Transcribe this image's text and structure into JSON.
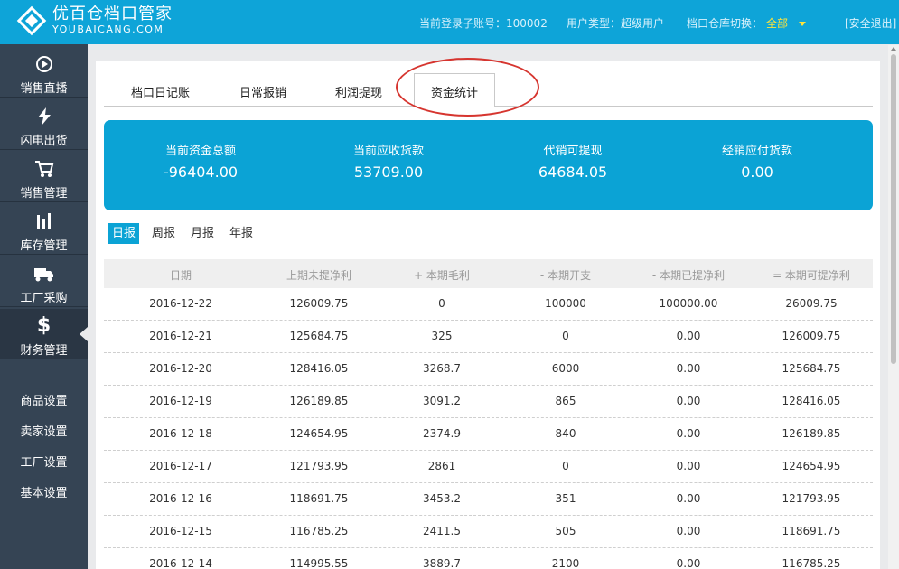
{
  "header": {
    "logo_cn": "优百仓档口管家",
    "logo_en": "YOUBAICANG.COM",
    "account_label": "当前登录子账号：",
    "account_value": "100002",
    "usertype_label": "用户类型：",
    "usertype_value": "超级用户",
    "switch_label": "档口仓库切换：",
    "switch_value": "全部",
    "logout": "[安全退出]"
  },
  "sidebar": {
    "items": [
      {
        "label": "销售直播",
        "icon": "play-circle-icon"
      },
      {
        "label": "闪电出货",
        "icon": "lightning-icon"
      },
      {
        "label": "销售管理",
        "icon": "cart-icon"
      },
      {
        "label": "库存管理",
        "icon": "bar-chart-icon"
      },
      {
        "label": "工厂采购",
        "icon": "truck-icon"
      },
      {
        "label": "财务管理",
        "icon": "dollar-icon"
      }
    ],
    "sub_items": [
      "商品设置",
      "卖家设置",
      "工厂设置",
      "基本设置"
    ]
  },
  "tabs": [
    "档口日记账",
    "日常报销",
    "利润提现",
    "资金统计"
  ],
  "summary": [
    {
      "title": "当前资金总额",
      "value": "-96404.00"
    },
    {
      "title": "当前应收货款",
      "value": "53709.00"
    },
    {
      "title": "代销可提现",
      "value": "64684.05"
    },
    {
      "title": "经销应付货款",
      "value": "0.00"
    }
  ],
  "periods": [
    "日报",
    "周报",
    "月报",
    "年报"
  ],
  "table": {
    "headers": [
      "日期",
      "上期未提净利",
      "+ 本期毛利",
      "- 本期开支",
      "- 本期已提净利",
      "= 本期可提净利"
    ],
    "rows": [
      [
        "2016-12-22",
        "126009.75",
        "0",
        "100000",
        "100000.00",
        "26009.75"
      ],
      [
        "2016-12-21",
        "125684.75",
        "325",
        "0",
        "0.00",
        "126009.75"
      ],
      [
        "2016-12-20",
        "128416.05",
        "3268.7",
        "6000",
        "0.00",
        "125684.75"
      ],
      [
        "2016-12-19",
        "126189.85",
        "3091.2",
        "865",
        "0.00",
        "128416.05"
      ],
      [
        "2016-12-18",
        "124654.95",
        "2374.9",
        "840",
        "0.00",
        "126189.85"
      ],
      [
        "2016-12-17",
        "121793.95",
        "2861",
        "0",
        "0.00",
        "124654.95"
      ],
      [
        "2016-12-16",
        "118691.75",
        "3453.2",
        "351",
        "0.00",
        "121793.95"
      ],
      [
        "2016-12-15",
        "116785.25",
        "2411.5",
        "505",
        "0.00",
        "118691.75"
      ],
      [
        "2016-12-14",
        "114995.55",
        "3889.7",
        "2100",
        "0.00",
        "116785.25"
      ]
    ]
  }
}
